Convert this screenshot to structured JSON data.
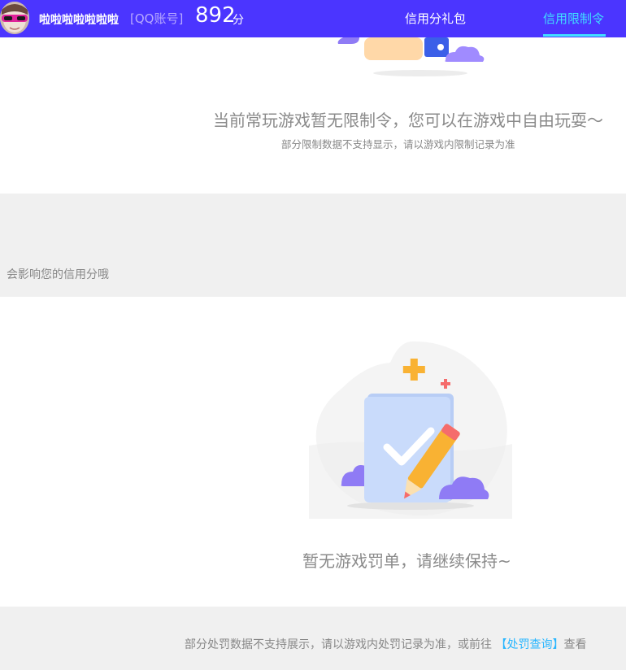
{
  "header": {
    "username": "啦啦啦啦啦啦啦",
    "account_type": "[QQ账号]",
    "score": "892",
    "score_unit": "分",
    "tabs": [
      {
        "label": "信用分礼包",
        "active": false
      },
      {
        "label": "信用限制令",
        "active": true
      }
    ]
  },
  "restriction": {
    "empty_message": "当前常玩游戏暂无限制令，您可以在游戏中自由玩耍～",
    "note": "部分限制数据不支持显示，请以游戏内限制记录为准"
  },
  "penalty": {
    "section_note": "会影响您的信用分哦",
    "empty_message": "暂无游戏罚单，请继续保持~",
    "footer_note": "部分处罚数据不支持展示，请以游戏内处罚记录为准，或前往",
    "footer_link": "【处罚查询】",
    "footer_tail": "查看"
  },
  "colors": {
    "header_bg": "#4b35ff",
    "active_tab": "#40e0ff",
    "link": "#28b6ff",
    "band_bg": "#f0f0f0"
  }
}
